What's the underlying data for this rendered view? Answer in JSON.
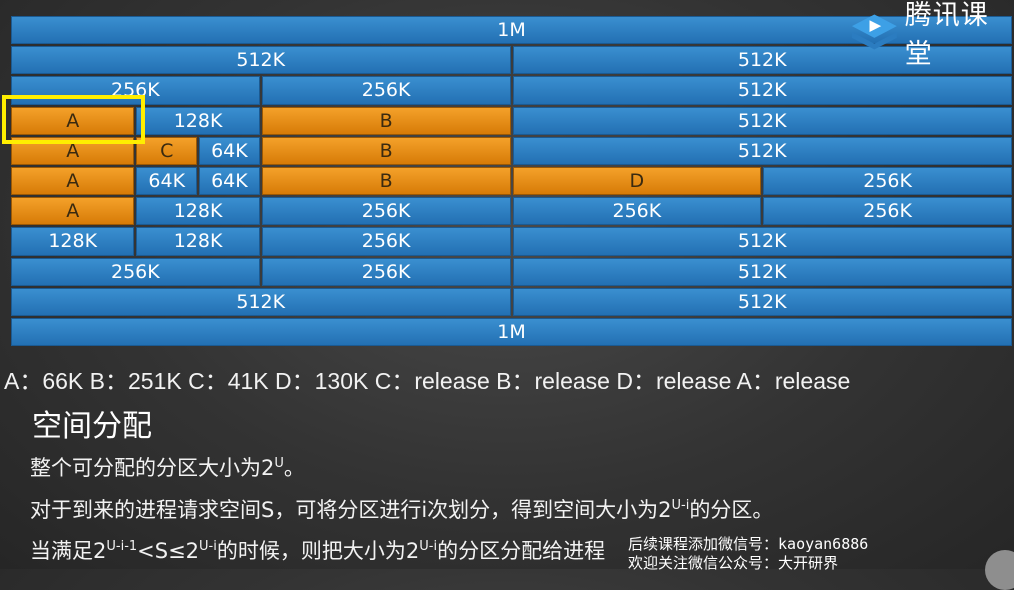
{
  "logo": {
    "text": "腾讯课堂",
    "icon": "tencent-classroom-play-icon"
  },
  "colors": {
    "free": "#2f7fc1",
    "allocated": "#e88d12",
    "highlight": "#ffee00"
  },
  "buddy_rows": [
    [
      {
        "label": "1M",
        "span": [
          0,
          16
        ],
        "state": "free"
      }
    ],
    [
      {
        "label": "512K",
        "span": [
          0,
          8
        ],
        "state": "free"
      },
      {
        "label": "512K",
        "span": [
          8,
          16
        ],
        "state": "free"
      }
    ],
    [
      {
        "label": "256K",
        "span": [
          0,
          4
        ],
        "state": "free"
      },
      {
        "label": "256K",
        "span": [
          4,
          8
        ],
        "state": "free"
      },
      {
        "label": "512K",
        "span": [
          8,
          16
        ],
        "state": "free"
      }
    ],
    [
      {
        "label": "A",
        "span": [
          0,
          2
        ],
        "state": "allocated"
      },
      {
        "label": "128K",
        "span": [
          2,
          4
        ],
        "state": "free"
      },
      {
        "label": "B",
        "span": [
          4,
          8
        ],
        "state": "allocated"
      },
      {
        "label": "512K",
        "span": [
          8,
          16
        ],
        "state": "free"
      }
    ],
    [
      {
        "label": "A",
        "span": [
          0,
          2
        ],
        "state": "allocated"
      },
      {
        "label": "C",
        "span": [
          2,
          3
        ],
        "state": "allocated"
      },
      {
        "label": "64K",
        "span": [
          3,
          4
        ],
        "state": "free"
      },
      {
        "label": "B",
        "span": [
          4,
          8
        ],
        "state": "allocated"
      },
      {
        "label": "512K",
        "span": [
          8,
          16
        ],
        "state": "free"
      }
    ],
    [
      {
        "label": "A",
        "span": [
          0,
          2
        ],
        "state": "allocated"
      },
      {
        "label": "64K",
        "span": [
          2,
          3
        ],
        "state": "free"
      },
      {
        "label": "64K",
        "span": [
          3,
          4
        ],
        "state": "free"
      },
      {
        "label": "B",
        "span": [
          4,
          8
        ],
        "state": "allocated"
      },
      {
        "label": "D",
        "span": [
          8,
          12
        ],
        "state": "allocated"
      },
      {
        "label": "256K",
        "span": [
          12,
          16
        ],
        "state": "free"
      }
    ],
    [
      {
        "label": "A",
        "span": [
          0,
          2
        ],
        "state": "allocated"
      },
      {
        "label": "128K",
        "span": [
          2,
          4
        ],
        "state": "free"
      },
      {
        "label": "256K",
        "span": [
          4,
          8
        ],
        "state": "free"
      },
      {
        "label": "256K",
        "span": [
          8,
          12
        ],
        "state": "free"
      },
      {
        "label": "256K",
        "span": [
          12,
          16
        ],
        "state": "free"
      }
    ],
    [
      {
        "label": "128K",
        "span": [
          0,
          2
        ],
        "state": "free"
      },
      {
        "label": "128K",
        "span": [
          2,
          4
        ],
        "state": "free"
      },
      {
        "label": "256K",
        "span": [
          4,
          8
        ],
        "state": "free"
      },
      {
        "label": "512K",
        "span": [
          8,
          16
        ],
        "state": "free"
      }
    ],
    [
      {
        "label": "256K",
        "span": [
          0,
          4
        ],
        "state": "free"
      },
      {
        "label": "256K",
        "span": [
          4,
          8
        ],
        "state": "free"
      },
      {
        "label": "512K",
        "span": [
          8,
          16
        ],
        "state": "free"
      }
    ],
    [
      {
        "label": "512K",
        "span": [
          0,
          8
        ],
        "state": "free"
      },
      {
        "label": "512K",
        "span": [
          8,
          16
        ],
        "state": "free"
      }
    ],
    [
      {
        "label": "1M",
        "span": [
          0,
          16
        ],
        "state": "free"
      }
    ]
  ],
  "sequence_text": "A：66K  B：251K  C：41K   D：130K  C：release  B：release  D：release  A：release",
  "section_title": "空间分配",
  "line1": {
    "pre": "整个可分配的分区大小为2",
    "sup": "U",
    "post": "。"
  },
  "line2": {
    "pre": "对于到来的进程请求空间S，可将分区进行i次划分，得到空间大小为2",
    "sup": "U-i",
    "post": "的分区。"
  },
  "line3": {
    "pre": "当满足2",
    "sup1": "U-i-1",
    "mid1": "<S≤2",
    "sup2": "U-i",
    "mid2": "的时候，则把大小为2",
    "sup3": "U-i",
    "post": "的分区分配给进程"
  },
  "watermark": {
    "line1": "后续课程添加微信号：kaoyan6886",
    "line2": "欢迎关注微信公众号：大开研界"
  }
}
